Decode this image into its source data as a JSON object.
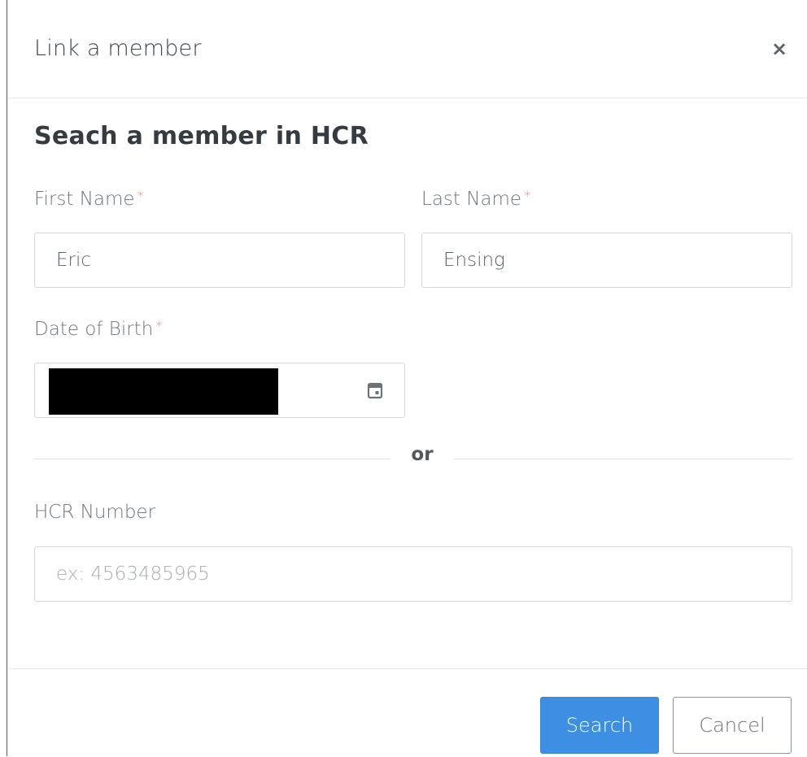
{
  "modal": {
    "title": "Link a member",
    "close_glyph": "×",
    "section_title": "Seach a member in HCR"
  },
  "form": {
    "first_name": {
      "label": "First Name",
      "required_mark": "*",
      "value": "Eric"
    },
    "last_name": {
      "label": "Last Name",
      "required_mark": "*",
      "value": "Ensing"
    },
    "date_of_birth": {
      "label": "Date of Birth",
      "required_mark": "*",
      "value_redacted": true,
      "icon": "calendar-icon"
    },
    "divider_text": "or",
    "hcr_number": {
      "label": "HCR Number",
      "placeholder": "ex: 4563485965",
      "value": ""
    }
  },
  "footer": {
    "search_label": "Search",
    "cancel_label": "Cancel"
  },
  "colors": {
    "primary": "#3d8fe3",
    "required": "#e07a7a",
    "border": "#d3d7db"
  }
}
